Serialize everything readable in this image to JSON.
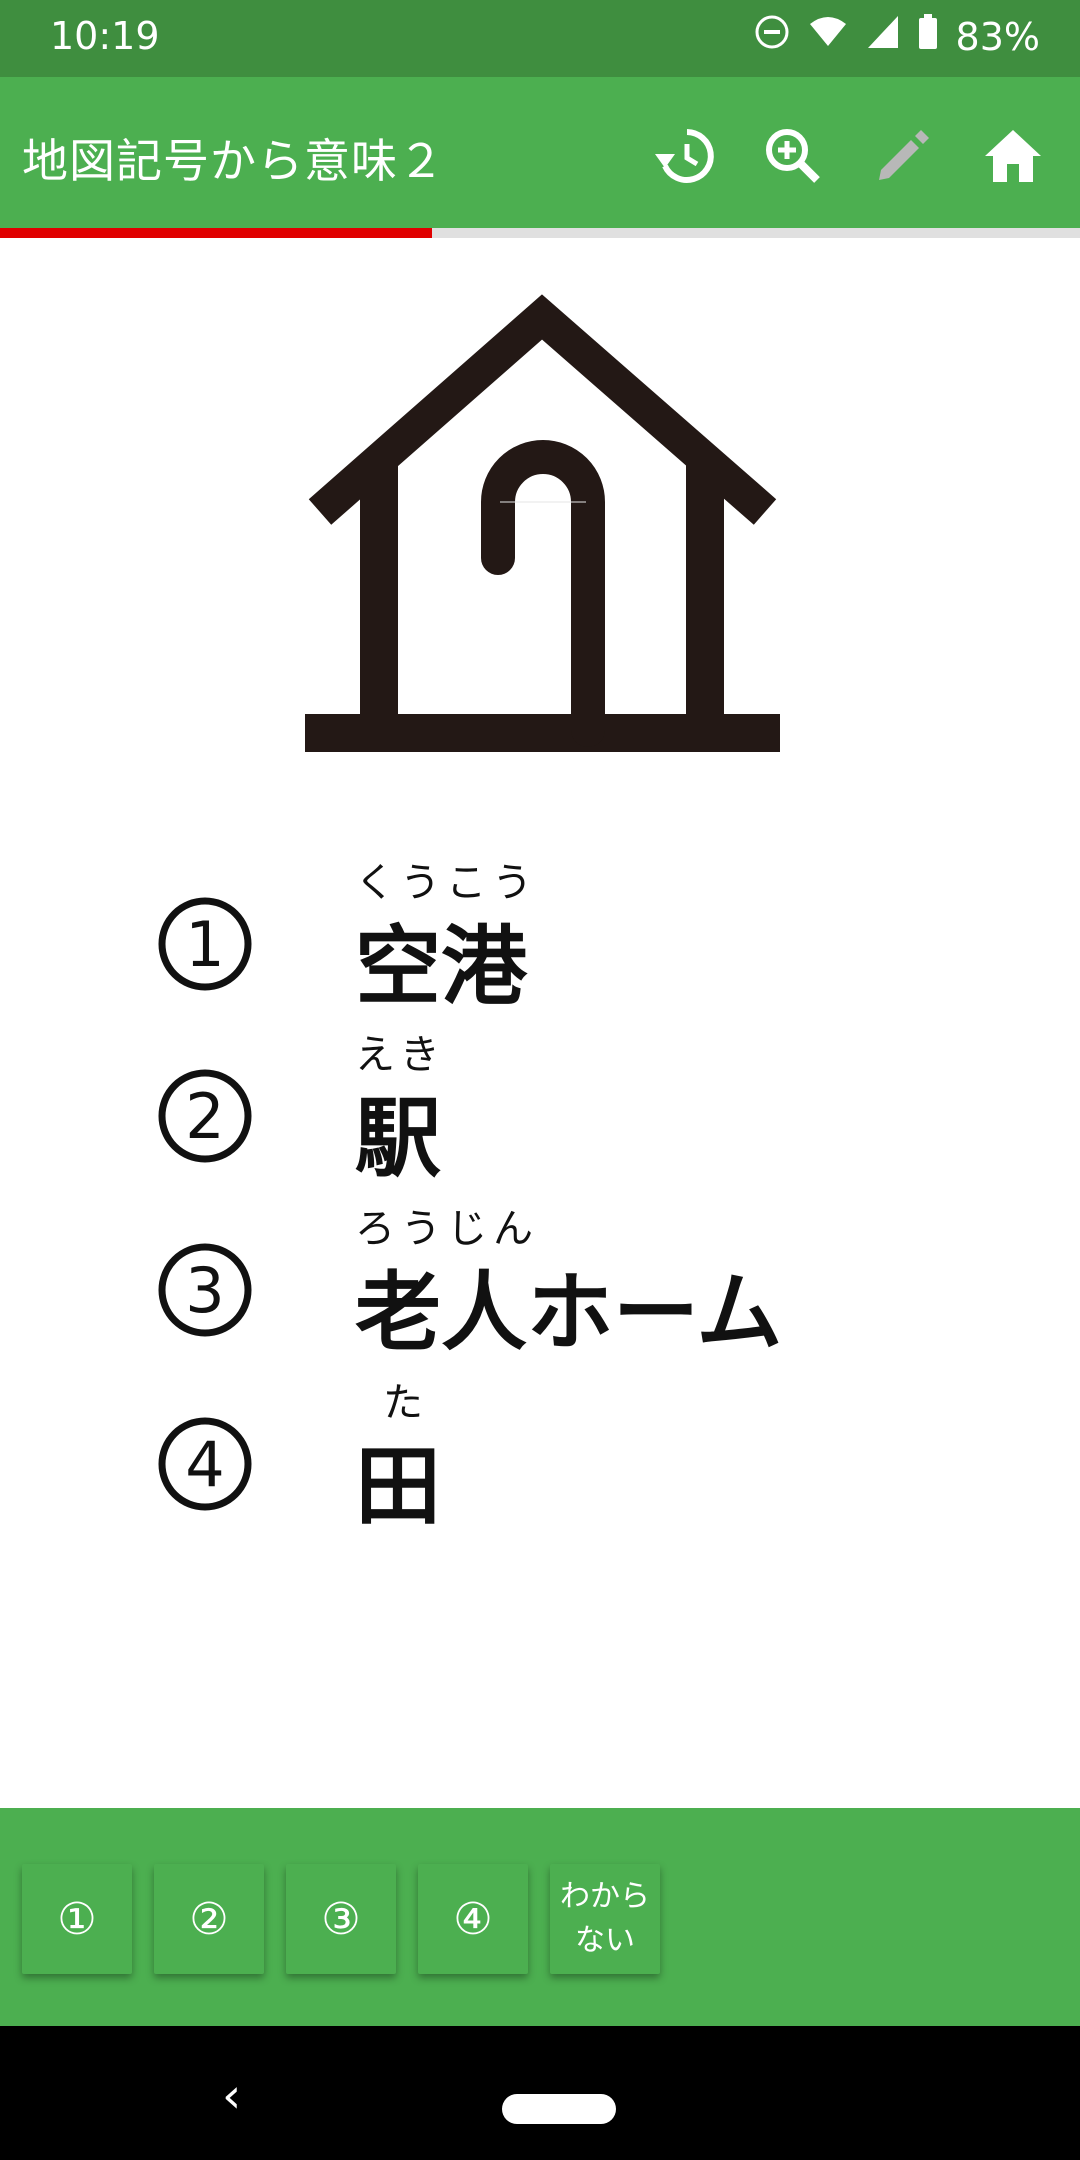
{
  "status": {
    "time": "10:19",
    "battery": "83%"
  },
  "app_bar": {
    "title": "地図記号から意味２",
    "icons": [
      "history-icon",
      "zoom-in-icon",
      "pencil-icon",
      "home-icon"
    ]
  },
  "progress": {
    "fraction": 0.4
  },
  "question": {
    "symbol_icon": "elderly-home-map-symbol"
  },
  "options": [
    {
      "number": "①",
      "ruby": "くうこう",
      "text": "空港"
    },
    {
      "number": "②",
      "ruby": "えき",
      "text": "駅"
    },
    {
      "number": "③",
      "ruby": "ろうじん",
      "text": "老人ホーム"
    },
    {
      "number": "④",
      "ruby": "た",
      "text": "田"
    }
  ],
  "answer_buttons": [
    "①",
    "②",
    "③",
    "④",
    "わから\nない"
  ],
  "colors": {
    "status_bar": "#3f8e3f",
    "app_bar": "#4caf50",
    "progress": "#e00000"
  }
}
